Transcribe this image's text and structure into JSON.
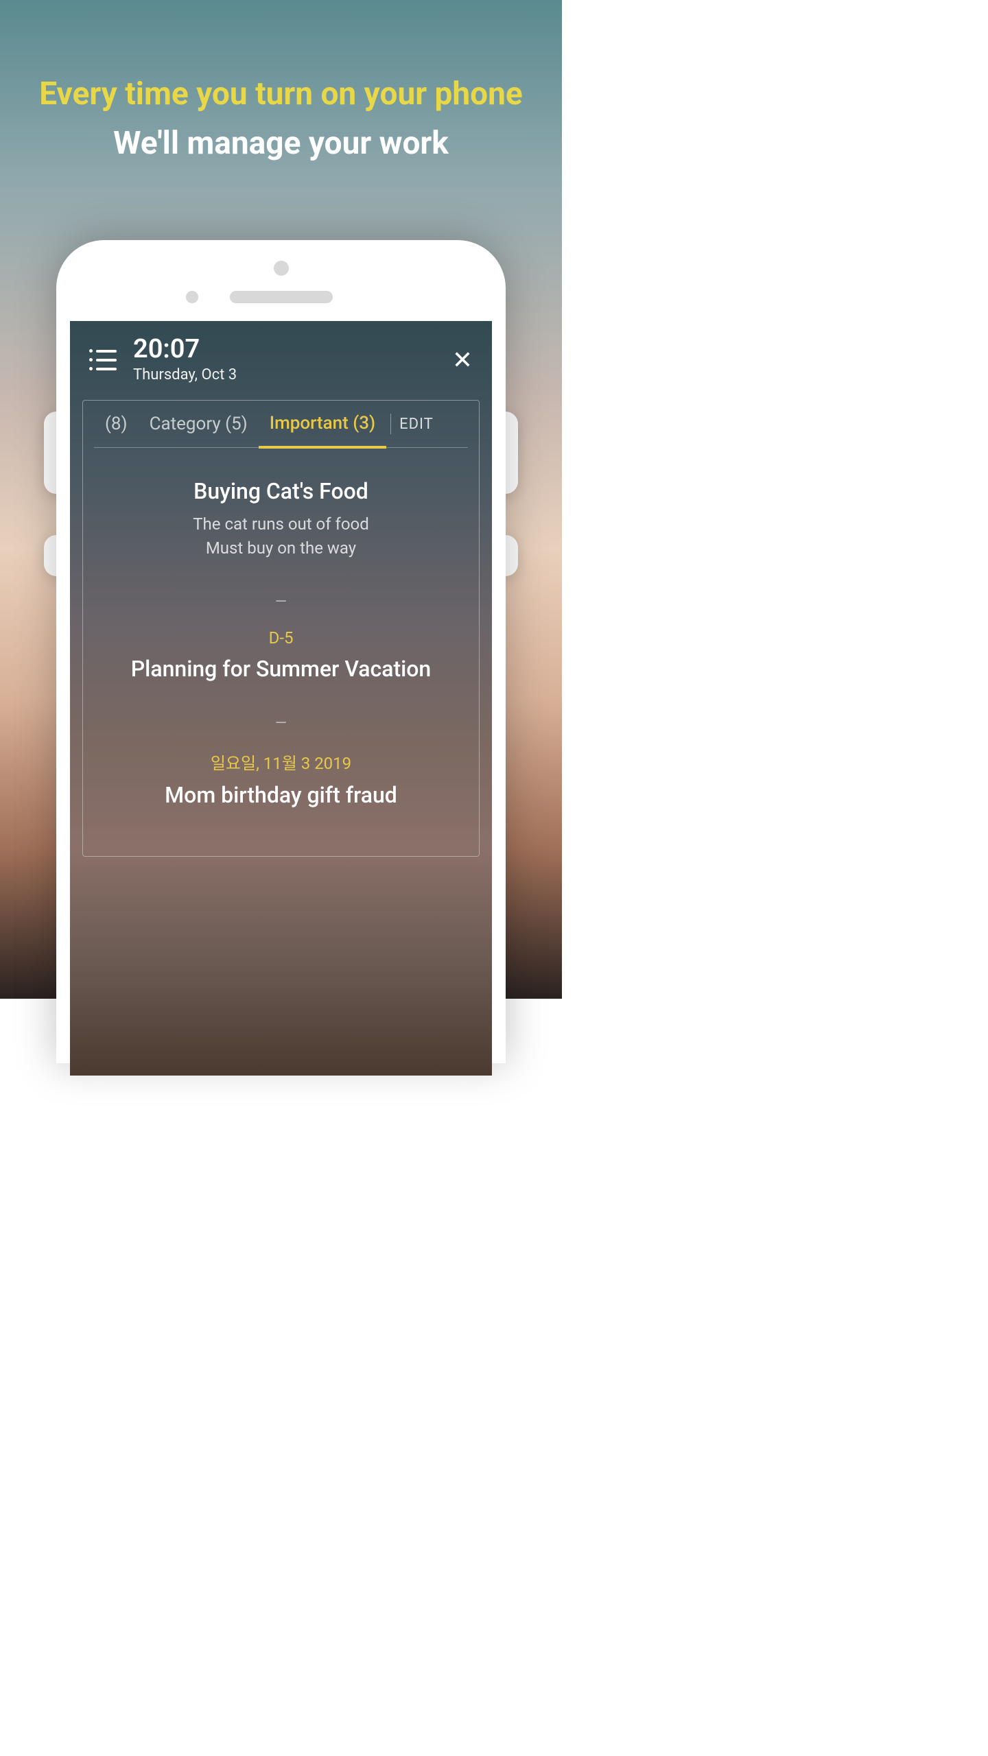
{
  "promo": {
    "line1": "Every time you turn on your phone",
    "line2": "We'll manage your work"
  },
  "header": {
    "time": "20:07",
    "date": "Thursday, Oct 3"
  },
  "tabs": {
    "all": "(8)",
    "category": "Category (5)",
    "important": "Important (3)",
    "edit": "EDIT"
  },
  "entries": [
    {
      "badge": "",
      "title": "Buying Cat's Food",
      "sub": "The cat runs out of food\nMust buy on the way"
    },
    {
      "badge": "D-5",
      "title": "Planning for Summer Vacation",
      "sub": ""
    },
    {
      "badge": "일요일, 11월 3 2019",
      "title": "Mom birthday gift fraud",
      "sub": ""
    }
  ]
}
